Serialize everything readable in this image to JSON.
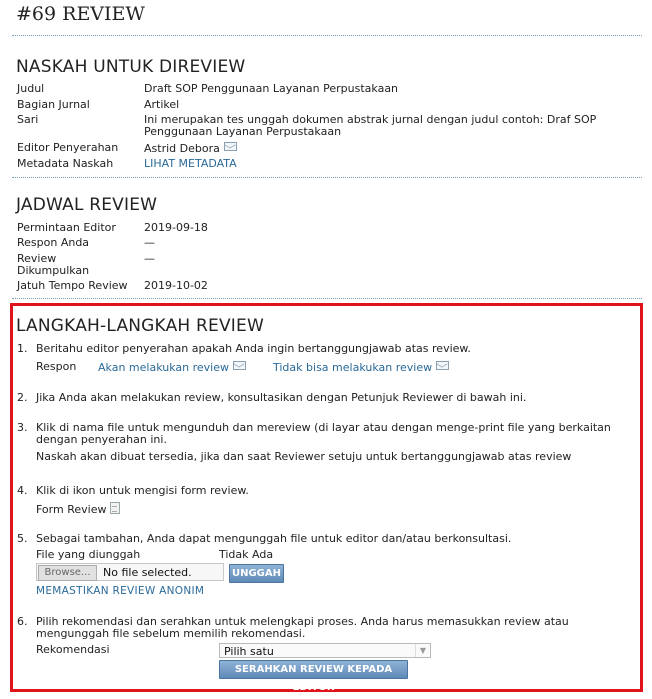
{
  "page_title": "#69 REVIEW",
  "naskah": {
    "title": "NASKAH UNTUK DIREVIEW",
    "rows": [
      {
        "label": "Judul",
        "value": "Draft SOP Penggunaan Layanan Perpustakaan"
      },
      {
        "label": "Bagian Jurnal",
        "value": "Artikel"
      },
      {
        "label": "Sari",
        "value": "Ini merupakan tes unggah dokumen abstrak jurnal dengan judul contoh: Draf SOP Penggunaan Layanan Perpustakaan"
      },
      {
        "label": "Editor Penyerahan",
        "value": "Astrid Debora"
      },
      {
        "label": "Metadata Naskah",
        "value": "LIHAT METADATA"
      }
    ]
  },
  "jadwal": {
    "title": "JADWAL REVIEW",
    "rows": [
      {
        "label": "Permintaan Editor",
        "value": "2019-09-18"
      },
      {
        "label": "Respon Anda",
        "value": "—"
      },
      {
        "label": "Review Dikumpulkan",
        "value": "—"
      },
      {
        "label": "Jatuh Tempo Review",
        "value": "2019-10-02"
      }
    ]
  },
  "langkah": {
    "title": "LANGKAH-LANGKAH REVIEW",
    "step1": {
      "num": "1.",
      "text": "Beritahu editor penyerahan apakah Anda ingin bertanggungjawab atas review.",
      "respon_label": "Respon",
      "accept_link": "Akan melakukan review",
      "decline_link": "Tidak bisa melakukan review"
    },
    "step2": {
      "num": "2.",
      "text": "Jika Anda akan melakukan review, konsultasikan dengan Petunjuk Reviewer di bawah ini."
    },
    "step3": {
      "num": "3.",
      "text": "Klik di nama file untuk mengunduh dan mereview (di layar atau dengan menge-print file yang berkaitan dengan penyerahan ini.",
      "note": "Naskah akan dibuat tersedia, jika dan saat Reviewer setuju untuk bertanggungjawab atas review"
    },
    "step4": {
      "num": "4.",
      "text": "Klik di ikon untuk mengisi form review.",
      "form_label": "Form Review"
    },
    "step5": {
      "num": "5.",
      "text": "Sebagai tambahan, Anda dapat mengunggah file untuk editor dan/atau berkonsultasi.",
      "uploaded_label": "File yang diunggah",
      "uploaded_value": "Tidak Ada",
      "browse_label": "Browse...",
      "file_status": "No file selected.",
      "upload_button": "UNGGAH",
      "anon_link": "MEMASTIKAN REVIEW ANONIM"
    },
    "step6": {
      "num": "6.",
      "text": "Pilih rekomendasi dan serahkan untuk melengkapi proses. Anda harus memasukkan review atau mengunggah file sebelum memilih rekomendasi.",
      "rek_label": "Rekomendasi",
      "select_value": "Pilih satu",
      "submit_button": "SERAHKAN REVIEW KEPADA EDITOR"
    }
  },
  "colors": {
    "accent_link": "#2a6a9a",
    "highlight_border": "#e0141c",
    "button": "#6a94c0"
  }
}
